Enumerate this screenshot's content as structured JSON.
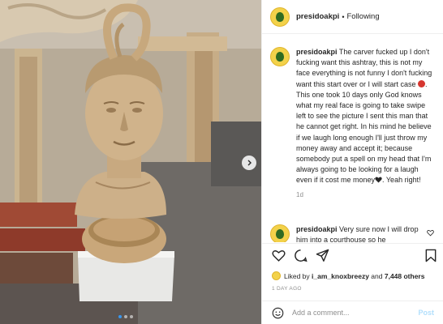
{
  "post": {
    "username": "presidoakpi",
    "separator": "•",
    "follow_status": "Following",
    "caption": {
      "username": "presidoakpi",
      "part1": "The carver fucked up I don't fucking want this ashtray, this is not my face everything is not funny I don't fucking want this start over or I will start case ",
      "part2": ". This one took 10 days only God knows what my real face is going to take swipe left to see the picture I sent this man that he cannot get right. In his mind he believe if we laugh long enough I'll just throw my money away and accept it; because somebody put a spell on my head that I'm always going to be looking for a laugh even if it cost me money",
      "part3": ". Yeah right!",
      "time": "1d"
    },
    "reply": {
      "username": "presidoakpi",
      "text": "Very sure now I will drop him into a courthouse so he"
    },
    "likes": {
      "prefix": "Liked by ",
      "user": "i_am_knoxbreezy",
      "middle": " and ",
      "count": "7,448 others"
    },
    "date": "1 DAY AGO",
    "comment_input": {
      "placeholder": "Add a comment..."
    },
    "post_label": "Post"
  },
  "icons": {
    "like": "heart-icon",
    "comment": "comment-icon",
    "share": "share-icon",
    "save": "bookmark-icon",
    "emoji": "smiley-icon",
    "next": "chevron-right-icon"
  },
  "colors": {
    "accent": "#3897f0",
    "post_disabled": "#b2dffc",
    "emoji_red": "#d6362f",
    "muted": "#8e8e8e"
  }
}
